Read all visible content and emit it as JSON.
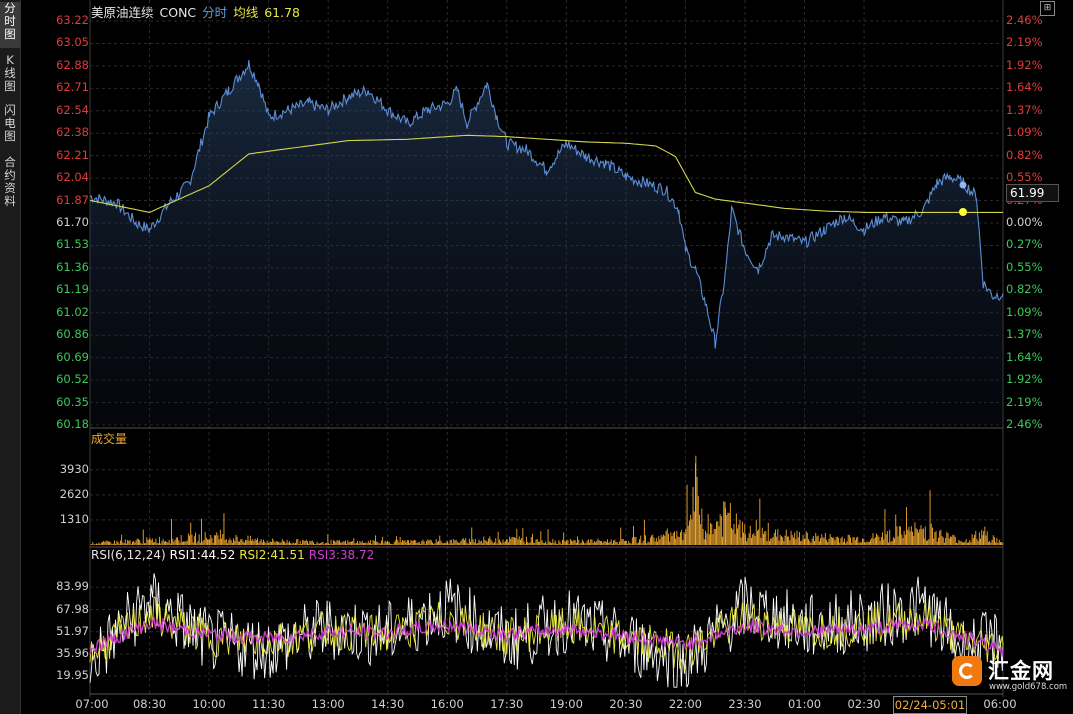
{
  "sidebar": {
    "tabs": [
      "分时图",
      "K线图",
      "闪电图",
      "合约资料"
    ],
    "active": 0
  },
  "header": {
    "name": "美原油连续",
    "code": "CONC",
    "mode": "分时",
    "avg_label": "均线",
    "avg_value": "61.78"
  },
  "price_axis_left": [
    "63.22",
    "63.05",
    "62.88",
    "62.71",
    "62.54",
    "62.38",
    "62.21",
    "62.04",
    "61.87",
    "61.70",
    "61.53",
    "61.36",
    "61.19",
    "61.02",
    "60.86",
    "60.69",
    "60.52",
    "60.35",
    "60.18"
  ],
  "pct_axis_right": [
    "2.46%",
    "2.19%",
    "1.92%",
    "1.64%",
    "1.37%",
    "1.09%",
    "0.82%",
    "0.55%",
    "0.27%",
    "0.00%",
    "0.27%",
    "0.55%",
    "0.82%",
    "1.09%",
    "1.37%",
    "1.64%",
    "1.92%",
    "2.19%",
    "2.46%"
  ],
  "current_price": "61.99",
  "volume": {
    "title": "成交量",
    "axis": [
      "3930",
      "2620",
      "1310"
    ]
  },
  "rsi": {
    "title": "RSI(6,12,24)",
    "rsi1": "RSI1:44.52",
    "rsi2": "RSI2:41.51",
    "rsi3": "RSI3:38.72",
    "axis": [
      "83.99",
      "67.98",
      "51.97",
      "35.96",
      "19.95"
    ]
  },
  "time_axis": [
    "07:00",
    "08:30",
    "10:00",
    "11:30",
    "13:00",
    "14:30",
    "16:00",
    "17:30",
    "19:00",
    "20:30",
    "22:00",
    "23:30",
    "01:00",
    "02:30",
    "06:00"
  ],
  "crosshair_time": "02/24-05:01",
  "logo": {
    "name": "汇金网",
    "url": "www.gold678.com"
  },
  "colors": {
    "up": "#e03c3c",
    "down": "#3cc85a",
    "neutral": "#d0d0d0",
    "price_line": "#5b8ed6",
    "avg_line": "#d4d44a",
    "volume": "#f0a830",
    "rsi1": "#ffffff",
    "rsi2": "#e8e840",
    "rsi3": "#d040d0"
  },
  "chart_data": [
    {
      "type": "line",
      "title": "",
      "series": [
        {
          "name": "",
          "x": [
            "07:00",
            "07:40",
            "08:10",
            "08:30",
            "09:00",
            "09:30",
            "10:00",
            "10:30",
            "11:00",
            "11:15",
            "11:30",
            "12:00",
            "12:30",
            "13:00",
            "13:30",
            "14:00",
            "14:30",
            "15:00",
            "15:30",
            "16:00",
            "16:15",
            "16:30",
            "17:00",
            "17:15",
            "17:30",
            "18:00",
            "18:30",
            "19:00",
            "19:30",
            "20:00",
            "20:30",
            "21:00",
            "21:30",
            "21:50",
            "22:00",
            "22:15",
            "22:30",
            "22:45",
            "23:00",
            "23:10",
            "23:30",
            "23:50",
            "00:10",
            "00:30",
            "01:00",
            "01:30",
            "02:00",
            "02:30",
            "03:00",
            "03:30",
            "04:00",
            "04:20",
            "04:40",
            "05:00",
            "05:20",
            "05:30",
            "05:45",
            "06:00"
          ],
          "values": [
            61.9,
            61.85,
            61.7,
            61.65,
            61.85,
            62.0,
            62.5,
            62.7,
            62.9,
            62.75,
            62.5,
            62.55,
            62.6,
            62.55,
            62.65,
            62.7,
            62.55,
            62.45,
            62.55,
            62.6,
            62.7,
            62.45,
            62.75,
            62.5,
            62.3,
            62.25,
            62.1,
            62.3,
            62.2,
            62.15,
            62.05,
            62.0,
            61.95,
            61.8,
            61.5,
            61.35,
            61.1,
            60.8,
            61.3,
            61.8,
            61.5,
            61.35,
            61.6,
            61.6,
            61.55,
            61.65,
            61.75,
            61.65,
            61.75,
            61.7,
            61.8,
            62.0,
            62.05,
            62.0,
            61.9,
            61.25,
            61.15,
            61.17
          ]
        },
        {
          "name": "",
          "x": [
            "07:00",
            "08:30",
            "10:00",
            "11:00",
            "12:00",
            "13:30",
            "15:00",
            "16:30",
            "17:30",
            "18:30",
            "19:30",
            "20:30",
            "21:15",
            "21:45",
            "22:15",
            "22:45",
            "23:30",
            "00:30",
            "01:30",
            "02:30",
            "03:30",
            "04:30",
            "05:30",
            "06:00"
          ],
          "values": [
            61.87,
            61.78,
            61.98,
            62.22,
            62.26,
            62.32,
            62.33,
            62.36,
            62.35,
            62.33,
            62.31,
            62.3,
            62.28,
            62.2,
            61.93,
            61.88,
            61.85,
            61.81,
            61.79,
            61.78,
            61.78,
            61.78,
            61.78,
            61.78
          ]
        }
      ],
      "ylim": [
        60.18,
        63.22
      ]
    },
    {
      "type": "bar",
      "title": "成交量",
      "yticks": [
        1310,
        2620,
        3930
      ],
      "series": [
        {
          "name": "",
          "x": [
            "07:00",
            "08:30",
            "10:00",
            "11:30",
            "13:00",
            "14:30",
            "16:00",
            "17:30",
            "19:00",
            "20:30",
            "21:30",
            "22:00",
            "22:15",
            "22:30",
            "23:00",
            "23:30",
            "01:00",
            "02:30",
            "04:00",
            "05:00",
            "05:30",
            "06:00"
          ],
          "values": [
            150,
            400,
            700,
            350,
            250,
            250,
            300,
            500,
            300,
            350,
            700,
            800,
            4500,
            900,
            2500,
            1000,
            700,
            500,
            1300,
            300,
            1000,
            100
          ]
        }
      ]
    },
    {
      "type": "line",
      "title": "RSI(6,12,24)",
      "ylim": [
        10,
        95
      ],
      "series": [
        {
          "name": "RSI1",
          "x": [
            "07:00",
            "08:30",
            "10:00",
            "11:30",
            "13:00",
            "14:30",
            "16:00",
            "17:30",
            "19:00",
            "20:30",
            "22:00",
            "23:30",
            "01:00",
            "02:30",
            "04:00",
            "05:00",
            "06:00"
          ],
          "values": [
            30,
            75,
            45,
            40,
            55,
            50,
            70,
            45,
            60,
            45,
            30,
            70,
            55,
            60,
            70,
            40,
            44.52
          ]
        },
        {
          "name": "RSI2",
          "x": [
            "07:00",
            "08:30",
            "10:00",
            "11:30",
            "13:00",
            "14:30",
            "16:00",
            "17:30",
            "19:00",
            "20:30",
            "22:00",
            "23:30",
            "01:00",
            "02:30",
            "04:00",
            "05:00",
            "06:00"
          ],
          "values": [
            35,
            65,
            48,
            45,
            53,
            50,
            62,
            48,
            56,
            47,
            38,
            62,
            53,
            56,
            63,
            45,
            41.51
          ]
        },
        {
          "name": "RSI3",
          "x": [
            "07:00",
            "08:30",
            "10:00",
            "11:30",
            "13:00",
            "14:30",
            "16:00",
            "17:30",
            "19:00",
            "20:30",
            "22:00",
            "23:30",
            "01:00",
            "02:30",
            "04:00",
            "05:00",
            "06:00"
          ],
          "values": [
            40,
            58,
            50,
            47,
            52,
            51,
            57,
            50,
            54,
            49,
            43,
            56,
            52,
            54,
            58,
            48,
            38.72
          ]
        }
      ]
    }
  ]
}
